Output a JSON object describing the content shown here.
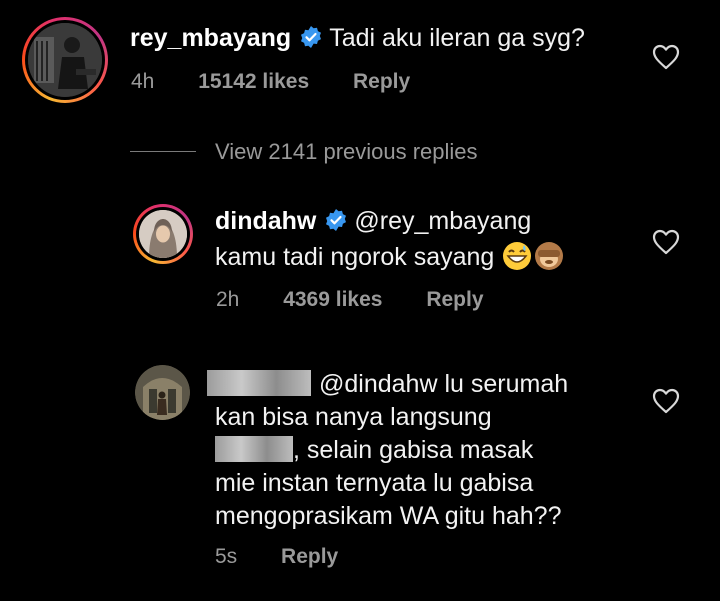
{
  "comment1": {
    "username": "rey_mbayang",
    "text": "Tadi aku ileran ga syg?",
    "time": "4h",
    "likes": "15142 likes",
    "reply": "Reply"
  },
  "view_replies": "View 2141 previous replies",
  "comment2": {
    "username": "dindahw",
    "mention": "@rey_mbayang",
    "text": "kamu tadi ngorok sayang",
    "time": "2h",
    "likes": "4369 likes",
    "reply": "Reply"
  },
  "comment3": {
    "line1": "@dindahw lu serumah",
    "line2": "kan bisa nanya langsung",
    "line3": ", selain gabisa masak",
    "line4": "mie instan ternyata lu gabisa",
    "line5": "mengoprasikam WA gitu hah??",
    "time": "5s",
    "reply": "Reply"
  },
  "icons": {
    "verified": "verified-badge-icon",
    "heart": "heart-outline-icon",
    "emoji1": "grinning-sweat-emoji",
    "emoji2": "see-no-evil-monkey-emoji"
  },
  "colors": {
    "background": "#000000",
    "verified": "#3897f0",
    "meta": "#9a9a9a"
  }
}
